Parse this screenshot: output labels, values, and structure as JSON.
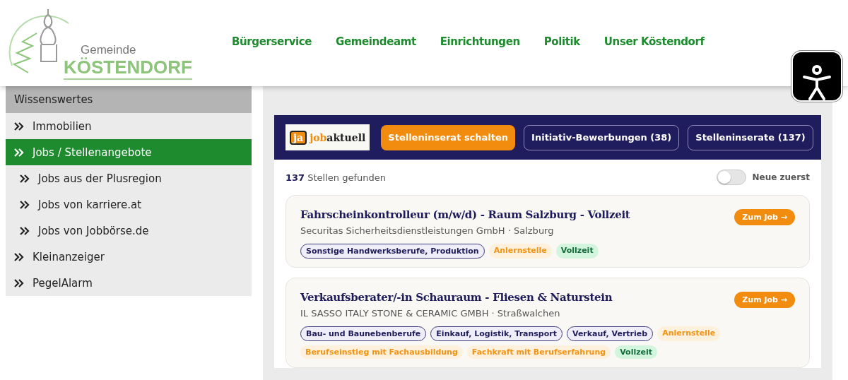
{
  "header": {
    "logo": {
      "line1": "Gemeinde",
      "line2": "KÖSTENDORF"
    },
    "nav": [
      {
        "label": "Bürgerservice"
      },
      {
        "label": "Gemeindeamt"
      },
      {
        "label": "Einrichtungen"
      },
      {
        "label": "Politik"
      },
      {
        "label": "Unser Köstendorf"
      }
    ]
  },
  "sidebar": {
    "title": "Wissenswertes",
    "items": [
      {
        "label": "Immobilien",
        "selected": false
      },
      {
        "label": "Jobs / Stellenangebote",
        "selected": true,
        "children": [
          {
            "label": "Jobs aus der Plusregion",
            "selected": false
          },
          {
            "label": "Jobs von karriere.at",
            "selected": false
          },
          {
            "label": "Jobs von Jobbörse.de",
            "selected": false
          }
        ]
      },
      {
        "label": "Kleinanzeiger",
        "selected": false
      },
      {
        "label": "PegelAlarm",
        "selected": false
      }
    ]
  },
  "jobs_widget": {
    "logo": {
      "badge": "ja",
      "word1": "job",
      "word2": "aktuell"
    },
    "buttons": [
      {
        "label": "Stelleninserat schalten",
        "kind": "primary"
      },
      {
        "label": "Initiativ-Bewerbungen (38)",
        "kind": "outline"
      },
      {
        "label": "Stelleninserate (137)",
        "kind": "outline"
      }
    ],
    "result_count": "137",
    "result_label": "Stellen gefunden",
    "sort_toggle": {
      "label": "Neue zuerst",
      "on": false
    },
    "jobs": [
      {
        "title": "Fahrscheinkontrolleur (m/w/d) - Raum Salzburg - Vollzeit",
        "company": "Securitas Sicherheitsdienstleistungen GmbH · Salzburg",
        "button": "Zum Job →",
        "tags": [
          {
            "label": "Sonstige Handwerksberufe, Produktion",
            "kind": "category"
          },
          {
            "label": "Anlernstelle",
            "kind": "level"
          },
          {
            "label": "Vollzeit",
            "kind": "hours"
          }
        ]
      },
      {
        "title": "Verkaufsberater/-in Schauraum - Fliesen & Naturstein",
        "company": "IL SASSO ITALY STONE & CERAMIC GMBH · Straßwalchen",
        "button": "Zum Job →",
        "tags": [
          {
            "label": "Bau- und Baunebenberufe",
            "kind": "category"
          },
          {
            "label": "Einkauf, Logistik, Transport",
            "kind": "category"
          },
          {
            "label": "Verkauf, Vertrieb",
            "kind": "category"
          },
          {
            "label": "Anlernstelle",
            "kind": "level"
          },
          {
            "label": "Berufseinstieg mit Fachausbildung",
            "kind": "level"
          },
          {
            "label": "Fachkraft mit Berufserfahrung",
            "kind": "level"
          },
          {
            "label": "Vollzeit",
            "kind": "hours"
          }
        ]
      }
    ]
  }
}
